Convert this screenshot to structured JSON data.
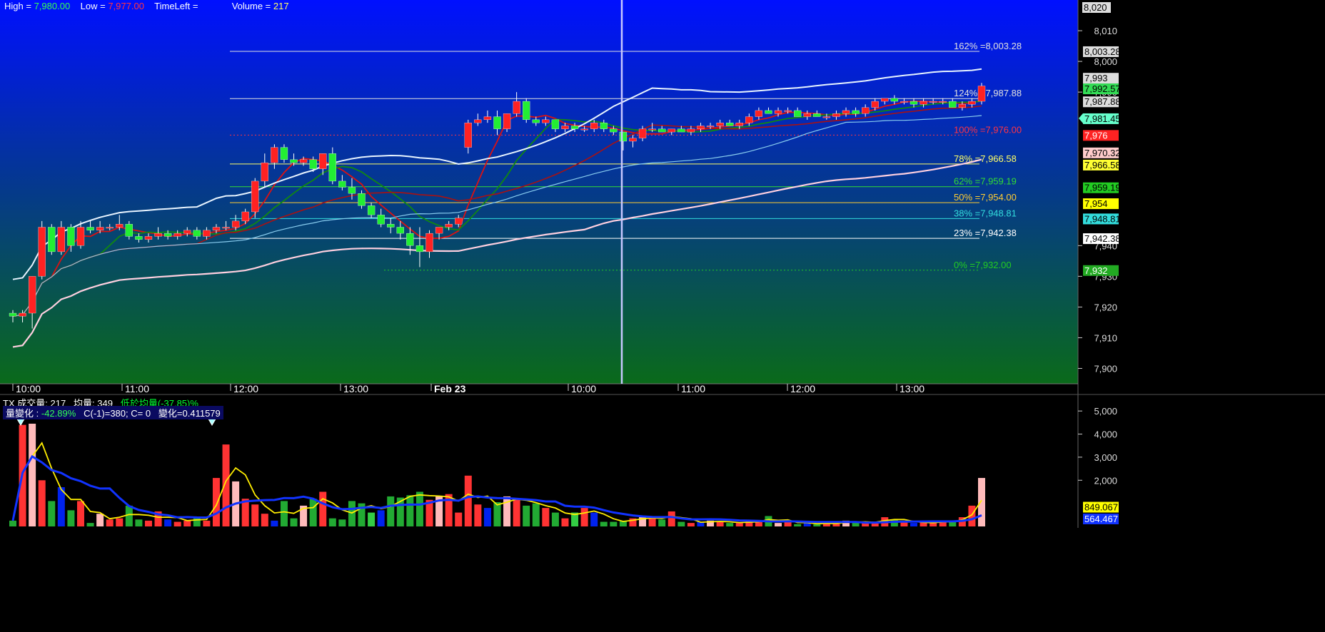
{
  "header": {
    "high_label": "High =",
    "high_value": "7,980.00",
    "low_label": "Low =",
    "low_value": "7,977.00",
    "timeleft_label": "TimeLeft =",
    "volume_label": "Volume =",
    "volume_value": "217"
  },
  "price_axis": {
    "ticks": [
      "8,010",
      "8,000",
      "7,990",
      "7,940",
      "7,930",
      "7,920",
      "7,910",
      "7,900"
    ],
    "top_value": "8,020",
    "tags": [
      {
        "text": "8,003.28",
        "bg": "#dddddd",
        "fg": "#000000"
      },
      {
        "text": "7,993",
        "bg": "#dddddd",
        "fg": "#000000"
      },
      {
        "text": "7,992.57",
        "bg": "#33dd55",
        "fg": "#000000"
      },
      {
        "text": "7,990",
        "bg": "#dddddd",
        "fg": "#000000"
      },
      {
        "text": "7,987.88",
        "bg": "#dddddd",
        "fg": "#000000"
      },
      {
        "text": "7,981.45",
        "bg": "#66ffcc",
        "fg": "#000000"
      },
      {
        "text": "7,976",
        "bg": "#ff2222",
        "fg": "#ffffff"
      },
      {
        "text": "7,970.32",
        "bg": "#ffcccc",
        "fg": "#000000"
      },
      {
        "text": "7,966.58",
        "bg": "#ffff33",
        "fg": "#000000"
      },
      {
        "text": "7,959.19",
        "bg": "#22cc22",
        "fg": "#000000"
      },
      {
        "text": "7,954",
        "bg": "#ffff00",
        "fg": "#000000"
      },
      {
        "text": "7,948.81",
        "bg": "#33dddd",
        "fg": "#000000"
      },
      {
        "text": "7,942.38",
        "bg": "#ffffff",
        "fg": "#000000"
      },
      {
        "text": "7,932",
        "bg": "#22aa22",
        "fg": "#ffffff"
      }
    ]
  },
  "fib_levels": [
    {
      "label": "162% =8,003.28",
      "value": 8003.28,
      "color": "#e0e0e0",
      "dotted": false
    },
    {
      "label": "124% =7,987.88",
      "value": 7987.88,
      "color": "#e0e0e0",
      "dotted": false
    },
    {
      "label": "100% =7,976.00",
      "value": 7976.0,
      "color": "#ff3344",
      "dotted": true
    },
    {
      "label": "78% =7,966.58",
      "value": 7966.58,
      "color": "#ffff66",
      "dotted": false
    },
    {
      "label": "62% =7,959.19",
      "value": 7959.19,
      "color": "#33dd33",
      "dotted": false
    },
    {
      "label": "50% =7,954.00",
      "value": 7954.0,
      "color": "#ffcc33",
      "dotted": false
    },
    {
      "label": "38% =7,948.81",
      "value": 7948.81,
      "color": "#33dddd",
      "dotted": false
    },
    {
      "label": "23% =7,942.38",
      "value": 7942.38,
      "color": "#ffffff",
      "dotted": false
    },
    {
      "label": "0% =7,932.00",
      "value": 7932.0,
      "color": "#22cc22",
      "dotted": true
    }
  ],
  "time_axis": [
    "10:00",
    "11:00",
    "12:00",
    "13:00",
    "Feb 23",
    "10:00",
    "11:00",
    "12:00",
    "13:00"
  ],
  "volume_panel": {
    "line1": {
      "symbol": "TX",
      "vol_label": "成交量:",
      "vol": "217",
      "avg_label": "均量:",
      "avg": "349",
      "cmp": "低於均量(-37.85)%"
    },
    "line2": {
      "chg_label": "量變化 :",
      "chg": "-42.89%",
      "c_prev": "C(-1)=380; C= 0",
      "var_label": "變化=0.411579"
    },
    "ticks": [
      "5,000",
      "4,000",
      "3,000",
      "2,000"
    ],
    "tag_avg": "849.067",
    "tag_avg2": "564.467"
  },
  "chart_data": [
    {
      "type": "candlestick",
      "title": "",
      "x": [
        "10:00",
        "11:00",
        "12:00",
        "13:00",
        "Feb 23",
        "10:00",
        "11:00",
        "12:00",
        "13:00"
      ],
      "ylim": [
        7895,
        8020
      ],
      "series_high": 7980.0,
      "series_low": 7977.0,
      "candles": [
        [
          7918,
          7919,
          7915,
          7917
        ],
        [
          7917,
          7919,
          7915,
          7918
        ],
        [
          7918,
          7930,
          7913,
          7930
        ],
        [
          7930,
          7948,
          7929,
          7946
        ],
        [
          7946,
          7947,
          7937,
          7938
        ],
        [
          7938,
          7948,
          7937,
          7946
        ],
        [
          7946,
          7947,
          7938,
          7940
        ],
        [
          7940,
          7948,
          7939,
          7946
        ],
        [
          7946,
          7948,
          7944,
          7945
        ],
        [
          7945,
          7948,
          7944,
          7946
        ],
        [
          7946,
          7947,
          7945,
          7946
        ],
        [
          7946,
          7950,
          7945,
          7947
        ],
        [
          7947,
          7948,
          7942,
          7943
        ],
        [
          7943,
          7944,
          7941,
          7942
        ],
        [
          7942,
          7944,
          7941,
          7943
        ],
        [
          7943,
          7946,
          7942,
          7944
        ],
        [
          7944,
          7945,
          7942,
          7943
        ],
        [
          7943,
          7945,
          7942,
          7944
        ],
        [
          7944,
          7946,
          7943,
          7945
        ],
        [
          7945,
          7946,
          7942,
          7943
        ],
        [
          7943,
          7946,
          7942,
          7945
        ],
        [
          7945,
          7947,
          7944,
          7946
        ],
        [
          7946,
          7948,
          7945,
          7946
        ],
        [
          7946,
          7950,
          7945,
          7948
        ],
        [
          7948,
          7952,
          7947,
          7951
        ],
        [
          7951,
          7962,
          7949,
          7961
        ],
        [
          7961,
          7970,
          7959,
          7967
        ],
        [
          7967,
          7973,
          7965,
          7972
        ],
        [
          7972,
          7973,
          7967,
          7968
        ],
        [
          7968,
          7970,
          7966,
          7967
        ],
        [
          7967,
          7969,
          7966,
          7968
        ],
        [
          7968,
          7969,
          7964,
          7965
        ],
        [
          7965,
          7970,
          7963,
          7970
        ],
        [
          7970,
          7972,
          7960,
          7961
        ],
        [
          7961,
          7963,
          7958,
          7959
        ],
        [
          7959,
          7962,
          7955,
          7957
        ],
        [
          7957,
          7958,
          7952,
          7953
        ],
        [
          7953,
          7954,
          7949,
          7950
        ],
        [
          7950,
          7952,
          7946,
          7947
        ],
        [
          7947,
          7949,
          7944,
          7946
        ],
        [
          7946,
          7948,
          7942,
          7944
        ],
        [
          7944,
          7946,
          7937,
          7940
        ],
        [
          7940,
          7946,
          7933,
          7938
        ],
        [
          7938,
          7945,
          7936,
          7944
        ],
        [
          7944,
          7946,
          7942,
          7946
        ],
        [
          7946,
          7948,
          7945,
          7947
        ],
        [
          7947,
          7950,
          7946,
          7949
        ],
        [
          7972,
          7981,
          7970,
          7980
        ],
        [
          7980,
          7983,
          7979,
          7981
        ],
        [
          7981,
          7984,
          7980,
          7982
        ],
        [
          7982,
          7984,
          7976,
          7978
        ],
        [
          7978,
          7983,
          7977,
          7983
        ],
        [
          7983,
          7990,
          7982,
          7987
        ],
        [
          7987,
          7988,
          7980,
          7981
        ],
        [
          7981,
          7982,
          7979,
          7980
        ],
        [
          7980,
          7982,
          7979,
          7981
        ],
        [
          7981,
          7981,
          7977,
          7978
        ],
        [
          7978,
          7980,
          7977,
          7979
        ],
        [
          7979,
          7980,
          7977,
          7978
        ],
        [
          7978,
          7979,
          7977,
          7978
        ],
        [
          7978,
          7981,
          7977,
          7980
        ],
        [
          7980,
          7981,
          7977,
          7978
        ],
        [
          7978,
          7979,
          7976,
          7977
        ],
        [
          7977,
          7977,
          7971,
          7974
        ],
        [
          7974,
          7976,
          7972,
          7975
        ],
        [
          7975,
          7979,
          7974,
          7978
        ],
        [
          7978,
          7980,
          7977,
          7978
        ],
        [
          7978,
          7979,
          7977,
          7977
        ],
        [
          7977,
          7978,
          7976,
          7978
        ],
        [
          7978,
          7979,
          7977,
          7977
        ],
        [
          7977,
          7979,
          7976,
          7978
        ],
        [
          7978,
          7980,
          7977,
          7979
        ],
        [
          7979,
          7980,
          7978,
          7979
        ],
        [
          7979,
          7981,
          7978,
          7980
        ],
        [
          7980,
          7981,
          7979,
          7979
        ],
        [
          7979,
          7981,
          7978,
          7980
        ],
        [
          7980,
          7983,
          7979,
          7982
        ],
        [
          7982,
          7985,
          7981,
          7984
        ],
        [
          7984,
          7985,
          7983,
          7983
        ],
        [
          7983,
          7985,
          7982,
          7984
        ],
        [
          7984,
          7985,
          7983,
          7984
        ],
        [
          7984,
          7985,
          7982,
          7982
        ],
        [
          7982,
          7984,
          7981,
          7983
        ],
        [
          7983,
          7984,
          7982,
          7982
        ],
        [
          7982,
          7983,
          7981,
          7982
        ],
        [
          7982,
          7984,
          7981,
          7983
        ],
        [
          7983,
          7985,
          7982,
          7984
        ],
        [
          7984,
          7985,
          7982,
          7983
        ],
        [
          7983,
          7986,
          7982,
          7985
        ],
        [
          7985,
          7988,
          7984,
          7987
        ],
        [
          7987,
          7988,
          7986,
          7988
        ],
        [
          7988,
          7989,
          7986,
          7987
        ],
        [
          7987,
          7988,
          7986,
          7987
        ],
        [
          7987,
          7988,
          7985,
          7986
        ],
        [
          7986,
          7988,
          7985,
          7987
        ],
        [
          7987,
          7988,
          7986,
          7987
        ],
        [
          7987,
          7988,
          7986,
          7987
        ],
        [
          7987,
          7988,
          7985,
          7985
        ],
        [
          7985,
          7987,
          7984,
          7986
        ],
        [
          7986,
          7988,
          7985,
          7987
        ],
        [
          7987,
          7993,
          7986,
          7992
        ]
      ]
    },
    {
      "type": "bar",
      "title": "",
      "ylim": [
        0,
        5500
      ],
      "volumes": [
        250,
        4400,
        4450,
        2000,
        1100,
        1700,
        700,
        1100,
        150,
        550,
        300,
        350,
        900,
        300,
        250,
        650,
        300,
        200,
        250,
        400,
        250,
        2100,
        3550,
        1950,
        1200,
        950,
        550,
        250,
        1100,
        350,
        900,
        1200,
        1500,
        350,
        300,
        1100,
        1000,
        600,
        700,
        1300,
        1250,
        1350,
        1500,
        1150,
        1300,
        1400,
        600,
        2200,
        950,
        800,
        1050,
        1300,
        1200,
        900,
        1000,
        800,
        600,
        350,
        600,
        800,
        600,
        200,
        200,
        250,
        350,
        400,
        350,
        300,
        650,
        200,
        150,
        200,
        250,
        200,
        150,
        150,
        250,
        200,
        450,
        150,
        250,
        100,
        150,
        100,
        150,
        120,
        250,
        200,
        150,
        200,
        400,
        300,
        200,
        150,
        180,
        150,
        250,
        200,
        400,
        900,
        2100
      ],
      "avg_line_value": 849.067,
      "avg_line2_value": 564.467
    }
  ],
  "colors": {
    "bull_candle": "#ff2222",
    "bear_candle": "#22ee33",
    "bg_top": "#0010ff",
    "bg_bottom": "#0a6a1a"
  }
}
